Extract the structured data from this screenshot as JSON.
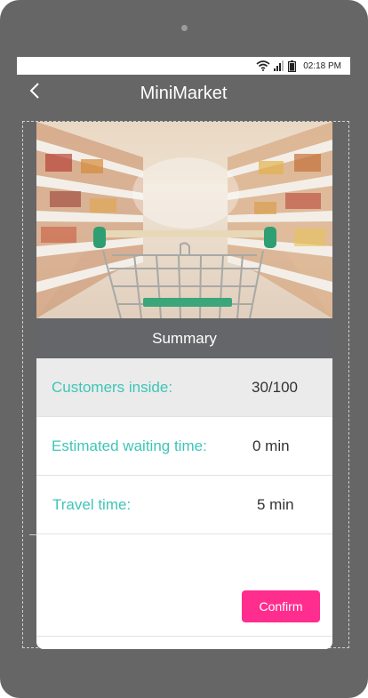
{
  "status": {
    "time": "02:18 PM",
    "icons": [
      "wifi-icon",
      "signal-icon",
      "battery-icon"
    ]
  },
  "nav": {
    "title": "MiniMarket",
    "back_icon": "chevron-left-icon"
  },
  "hero": {
    "image": "shopping-cart-in-supermarket-aisle"
  },
  "summary": {
    "header": "Summary",
    "rows": [
      {
        "label": "Customers inside:",
        "value": "30/100"
      },
      {
        "label": "Estimated waiting time:",
        "value": "0 min"
      },
      {
        "label": "Travel time:",
        "value": "5 min"
      }
    ]
  },
  "actions": {
    "confirm_label": "Confirm"
  },
  "colors": {
    "device": "#666666",
    "header_bar": "#646669",
    "label_teal": "#3fc5b8",
    "confirm_pink": "#ff2d8e",
    "shaded_row": "#ebebeb"
  }
}
